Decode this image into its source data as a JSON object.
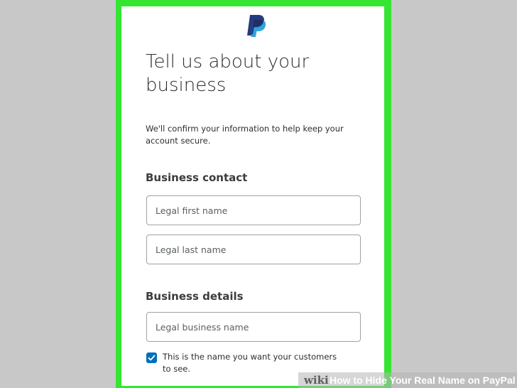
{
  "brand": {
    "logo_icon": "paypal-logo-icon",
    "colors": {
      "frame_green": "#34e632",
      "paypal_dark_blue": "#253b80",
      "paypal_light_blue": "#179bd7",
      "checkbox_blue": "#0070ba",
      "text": "#2c2e2f"
    }
  },
  "page": {
    "title": "Tell us about your business",
    "intro": "We'll confirm your information to help keep your account secure."
  },
  "business_contact": {
    "heading": "Business contact",
    "first_name_placeholder": "Legal first name",
    "last_name_placeholder": "Legal last name"
  },
  "business_details": {
    "heading": "Business details",
    "business_name_placeholder": "Legal business name",
    "customer_name_checkbox": {
      "checked": true,
      "label": "This is the name you want your customers to see."
    }
  },
  "watermark": {
    "wiki": "wiki",
    "text": "How to Hide Your Real Name on PayPal"
  }
}
